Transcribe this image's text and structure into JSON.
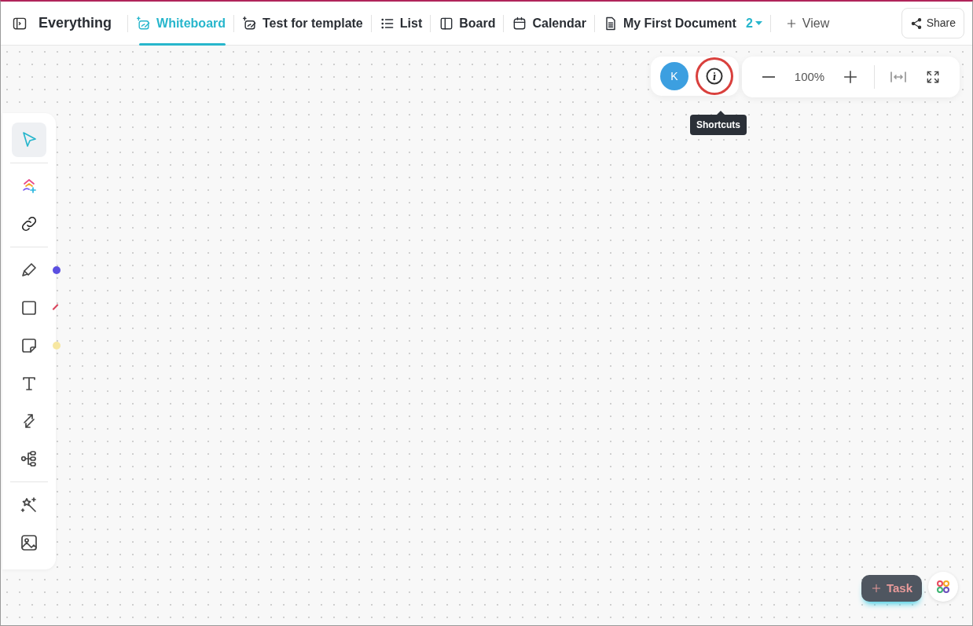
{
  "header": {
    "title": "Everything"
  },
  "tabs": [
    {
      "label": "Whiteboard",
      "kind": "whiteboard",
      "selected": true
    },
    {
      "label": "Test for template",
      "kind": "whiteboard",
      "selected": false
    },
    {
      "label": "List",
      "kind": "list",
      "selected": false
    },
    {
      "label": "Board",
      "kind": "board",
      "selected": false
    },
    {
      "label": "Calendar",
      "kind": "calendar",
      "selected": false
    },
    {
      "label": "My First Document",
      "kind": "doc",
      "selected": false,
      "count": "2"
    }
  ],
  "add_view": {
    "label": "View"
  },
  "share": {
    "label": "Share"
  },
  "collab": {
    "avatar": "K",
    "tooltip": "Shortcuts",
    "highlighted": true
  },
  "zoom": {
    "value": "100%"
  },
  "tools": [
    [
      {
        "kind": "pointer",
        "selected": true
      }
    ],
    [
      {
        "kind": "templates",
        "selected": false
      },
      {
        "kind": "link",
        "selected": false
      }
    ],
    [
      {
        "kind": "pen",
        "selected": false,
        "color": "#5b4fe0"
      },
      {
        "kind": "rect",
        "selected": false,
        "color": "#d9425a"
      },
      {
        "kind": "sticky",
        "selected": false,
        "color": "#f7e7a1"
      },
      {
        "kind": "text",
        "selected": false
      },
      {
        "kind": "connector",
        "selected": false
      },
      {
        "kind": "mindmap",
        "selected": false
      }
    ],
    [
      {
        "kind": "magic",
        "selected": false
      },
      {
        "kind": "image",
        "selected": false
      }
    ]
  ],
  "task_button": {
    "label": "Task"
  }
}
